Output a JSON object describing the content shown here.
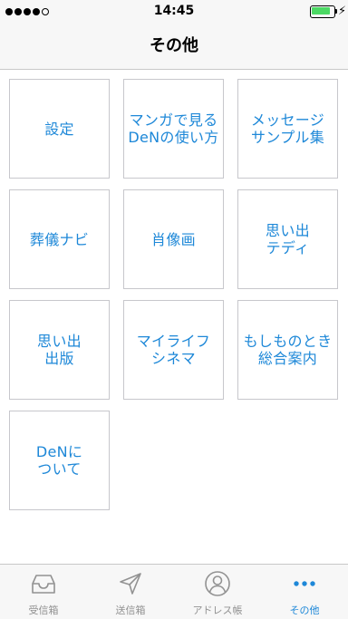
{
  "status_bar": {
    "time": "14:45",
    "signal_bars_filled": 4,
    "signal_bars_total": 5,
    "battery_level": 0.9
  },
  "nav": {
    "title": "その他"
  },
  "tiles": [
    {
      "label": "設定"
    },
    {
      "label": "マンガで見る\nDeNの使い方"
    },
    {
      "label": "メッセージ\nサンプル集"
    },
    {
      "label": "葬儀ナビ"
    },
    {
      "label": "肖像画"
    },
    {
      "label": "思い出\nテディ"
    },
    {
      "label": "思い出\n出版"
    },
    {
      "label": "マイライフ\nシネマ"
    },
    {
      "label": "もしものとき\n総合案内"
    },
    {
      "label": "DeNに\nついて"
    }
  ],
  "tab_bar": {
    "tabs": [
      {
        "label": "受信箱",
        "icon": "inbox-icon"
      },
      {
        "label": "送信箱",
        "icon": "send-icon"
      },
      {
        "label": "アドレス帳",
        "icon": "contact-icon"
      },
      {
        "label": "その他",
        "icon": "more-icon",
        "active": true
      }
    ]
  },
  "colors": {
    "accent": "#1e88d8",
    "inactive": "#929292",
    "battery": "#4cd964"
  }
}
